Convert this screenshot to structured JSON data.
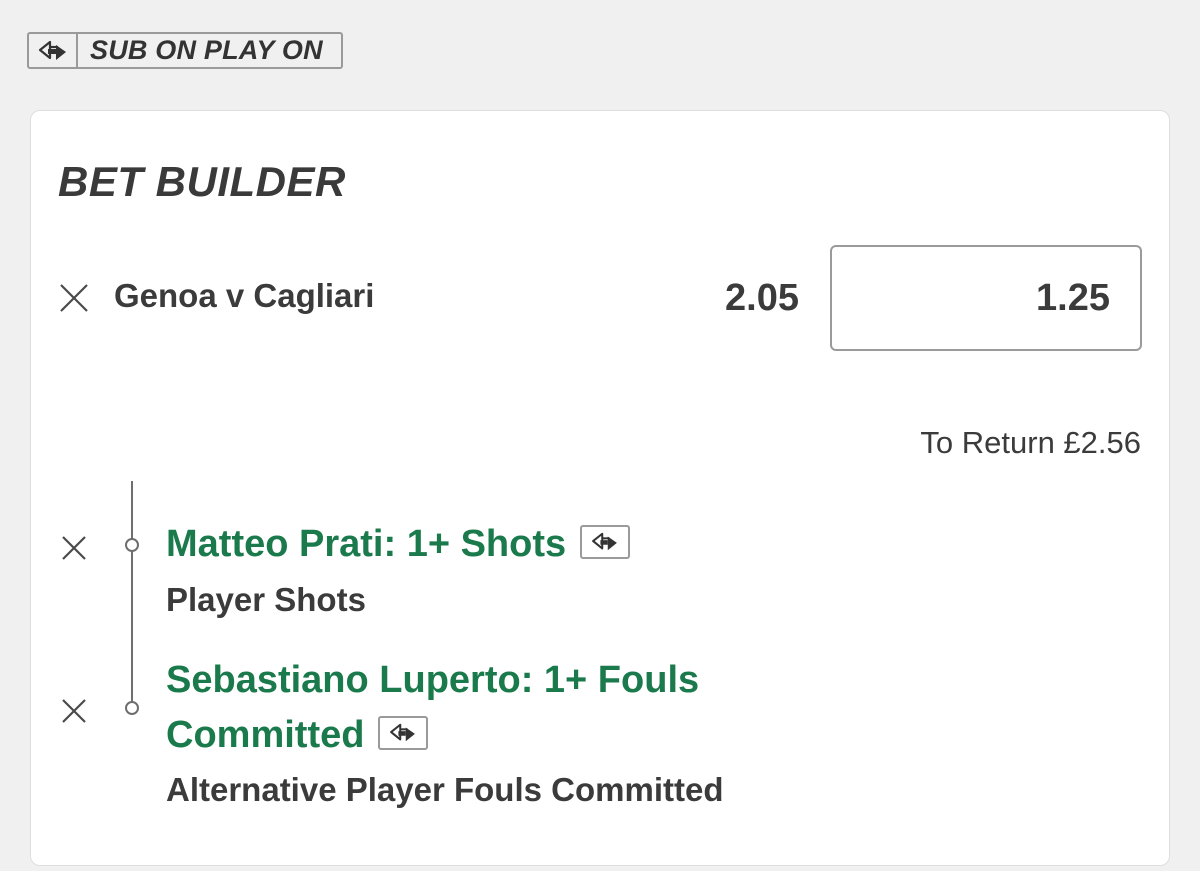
{
  "badge": {
    "label": "SUB ON PLAY ON",
    "icon": "sub-on-play-on-icon"
  },
  "card": {
    "title": "BET BUILDER",
    "event": {
      "name": "Genoa v Cagliari",
      "odds": "2.05",
      "stake": "1.25",
      "to_return": "To Return £2.56"
    },
    "selections": [
      {
        "title_line1": "Matteo Prati: 1+ Shots",
        "title_line2": "",
        "market": "Player Shots"
      },
      {
        "title_line1": "Sebastiano Luperto: 1+ Fouls",
        "title_line2": "Committed",
        "market": "Alternative Player Fouls Committed"
      }
    ]
  },
  "colors": {
    "background": "#f0f0f0",
    "card": "#ffffff",
    "selection_green": "#1a7a4c",
    "text": "#3b3b3b",
    "border": "#9a9a9a"
  }
}
